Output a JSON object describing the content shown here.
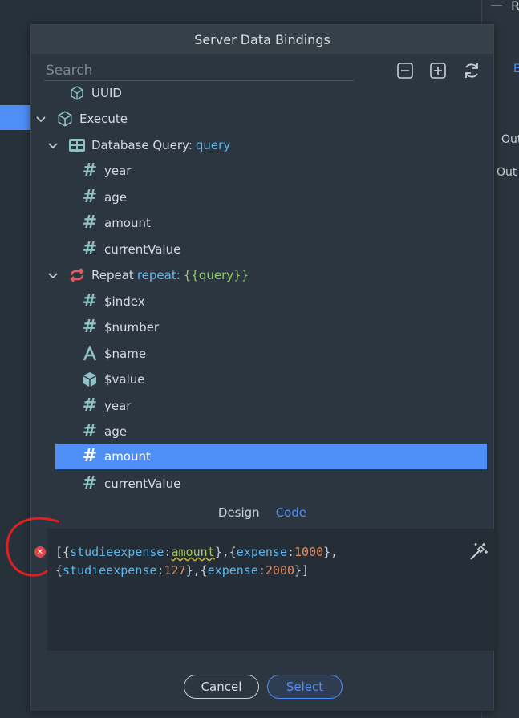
{
  "dialog": {
    "title": "Server Data Bindings",
    "search_placeholder": "Search"
  },
  "tree": {
    "uuid_label": "UUID",
    "execute_label": "Execute",
    "db_query_label": "Database Query: ",
    "db_query_name": "query",
    "db_fields": [
      "year",
      "age",
      "amount",
      "currentValue"
    ],
    "repeat_label": "Repeat ",
    "repeat_name": "repeat: ",
    "repeat_binding": "{{query}}",
    "repeat_fields": [
      {
        "label": "$index",
        "type": "number"
      },
      {
        "label": "$number",
        "type": "number"
      },
      {
        "label": "$name",
        "type": "text"
      },
      {
        "label": "$value",
        "type": "object"
      },
      {
        "label": "year",
        "type": "number"
      },
      {
        "label": "age",
        "type": "number"
      },
      {
        "label": "amount",
        "type": "number",
        "selected": true
      },
      {
        "label": "currentValue",
        "type": "number"
      }
    ]
  },
  "tabs": {
    "design": "Design",
    "code": "Code"
  },
  "code": {
    "line1_p1": "[{",
    "line1_k1": "studieexpense",
    "line1_colon1": ":",
    "line1_v1": "amount",
    "line1_p2": "},{",
    "line1_k2": "expense",
    "line1_colon2": ":",
    "line1_v2": "1000",
    "line1_p3": "},",
    "line2_p1": "{",
    "line2_k1": "studieexpense",
    "line2_colon1": ":",
    "line2_v1": "127",
    "line2_p2": "},{",
    "line2_k2": "expense",
    "line2_colon2": ":",
    "line2_v2": "2000",
    "line2_p3": "}]"
  },
  "buttons": {
    "cancel": "Cancel",
    "select": "Select"
  },
  "background": {
    "r_label": "R",
    "e_label": "E",
    "out1": "Out",
    "out2": "Out"
  },
  "colors": {
    "accent": "#4f8ff7",
    "panel": "#2c3640",
    "hash_icon": "#8fc2c4",
    "repeat_icon": "#e06060",
    "annotation": "#e02020"
  }
}
